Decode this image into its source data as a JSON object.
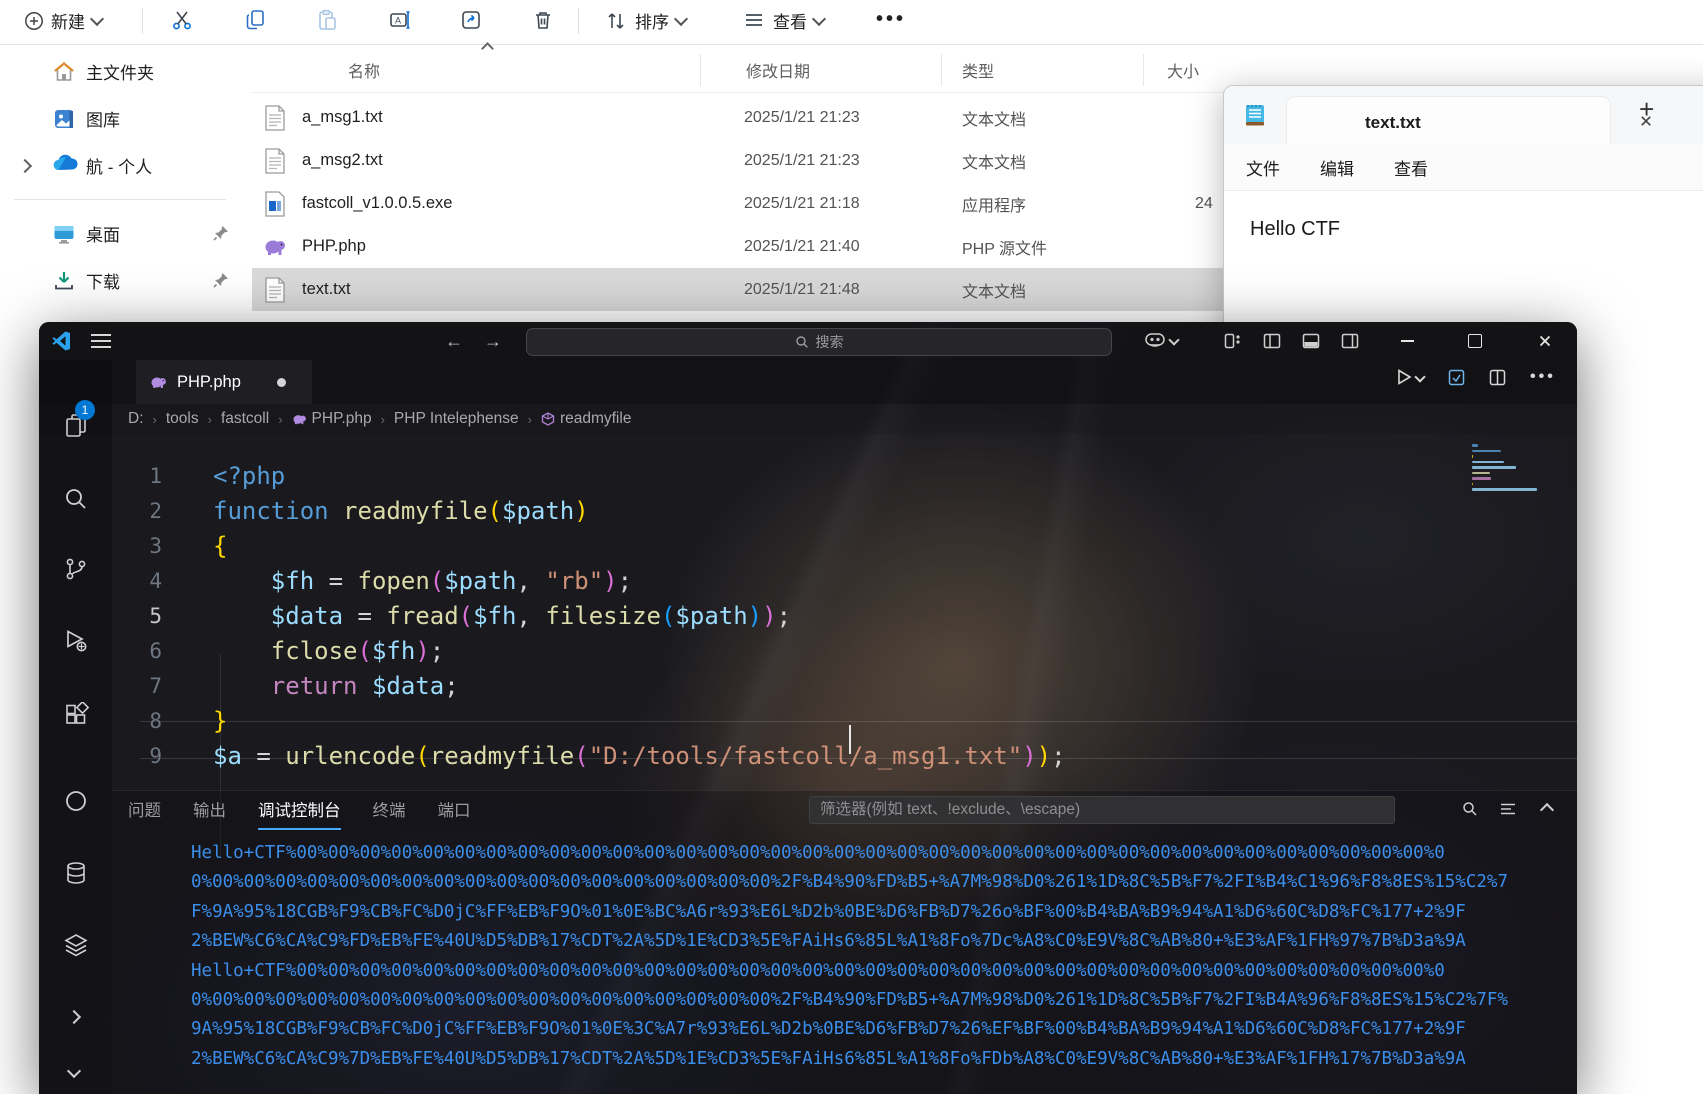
{
  "colors": {
    "accent": "#0078d4",
    "debug_console_text": "#3b8eea",
    "panel_tab_underline": "#47a9ff",
    "selected_row": "#d9d9d9"
  },
  "explorer": {
    "toolbar": {
      "new_label": "新建",
      "sort_label": "排序",
      "view_label": "查看",
      "icon_names": [
        "plus-circle-icon",
        "cut-icon",
        "copy-icon",
        "paste-icon",
        "rename-icon",
        "share-icon",
        "delete-icon",
        "sort-icon",
        "view-icon",
        "more-icon"
      ]
    },
    "columns": {
      "name": "名称",
      "modified": "修改日期",
      "type": "类型",
      "size": "大小"
    },
    "sidebar": [
      {
        "label": "主文件夹",
        "icon": "home-icon"
      },
      {
        "label": "图库",
        "icon": "gallery-icon"
      },
      {
        "label": "航 - 个人",
        "icon": "onedrive-icon",
        "expandable": true
      },
      {
        "divider": true
      },
      {
        "label": "桌面",
        "icon": "desktop-icon",
        "pinned": true
      },
      {
        "label": "下载",
        "icon": "download-icon",
        "pinned": true
      }
    ],
    "files": [
      {
        "name": "a_msg1.txt",
        "date": "2025/1/21 21:23",
        "type": "文本文档",
        "size": "",
        "icon": "txt",
        "selected": false
      },
      {
        "name": "a_msg2.txt",
        "date": "2025/1/21 21:23",
        "type": "文本文档",
        "size": "",
        "icon": "txt",
        "selected": false
      },
      {
        "name": "fastcoll_v1.0.0.5.exe",
        "date": "2025/1/21 21:18",
        "type": "应用程序",
        "size": "24",
        "icon": "exe",
        "selected": false
      },
      {
        "name": "PHP.php",
        "date": "2025/1/21 21:40",
        "type": "PHP 源文件",
        "size": "",
        "icon": "php",
        "selected": false
      },
      {
        "name": "text.txt",
        "date": "2025/1/21 21:48",
        "type": "文本文档",
        "size": "",
        "icon": "txt",
        "selected": true
      }
    ]
  },
  "notepad": {
    "tab_title": "text.txt",
    "menus": [
      "文件",
      "编辑",
      "查看"
    ],
    "body_text": "Hello CTF"
  },
  "vscode": {
    "command_center_label": "搜索",
    "tab": {
      "label": "PHP.php",
      "modified": true
    },
    "breadcrumbs": [
      {
        "label": "D:"
      },
      {
        "label": "tools"
      },
      {
        "label": "fastcoll"
      },
      {
        "label": "PHP.php",
        "icon": "php-elephant-icon"
      },
      {
        "label": "PHP Intelephense"
      },
      {
        "label": "readmyfile",
        "icon": "symbol-method-icon"
      }
    ],
    "activity_badge": "1",
    "code": {
      "lines": [
        [
          [
            "<?php",
            "c-kw"
          ]
        ],
        [
          [
            "function ",
            "c-kw"
          ],
          [
            "readmyfile",
            "c-fn"
          ],
          [
            "(",
            "c-b1"
          ],
          [
            "$path",
            "c-var"
          ],
          [
            ")",
            "c-b1"
          ]
        ],
        [
          [
            "{",
            "c-b1"
          ]
        ],
        [
          [
            "    ",
            "c-pl"
          ],
          [
            "$fh",
            "c-var"
          ],
          [
            " = ",
            "c-pl"
          ],
          [
            "fopen",
            "c-fn"
          ],
          [
            "(",
            "c-b2"
          ],
          [
            "$path",
            "c-var"
          ],
          [
            ", ",
            "c-pl"
          ],
          [
            "\"rb\"",
            "c-str"
          ],
          [
            ")",
            "c-b2"
          ],
          [
            ";",
            "c-pl"
          ]
        ],
        [
          [
            "    ",
            "c-pl"
          ],
          [
            "$data",
            "c-var"
          ],
          [
            " = ",
            "c-pl"
          ],
          [
            "fread",
            "c-fn"
          ],
          [
            "(",
            "c-b2"
          ],
          [
            "$fh",
            "c-var"
          ],
          [
            ", ",
            "c-pl"
          ],
          [
            "filesize",
            "c-fn"
          ],
          [
            "(",
            "c-b3"
          ],
          [
            "$path",
            "c-var"
          ],
          [
            ")",
            "c-b3"
          ],
          [
            ")",
            "c-b2"
          ],
          [
            ";",
            "c-pl"
          ]
        ],
        [
          [
            "    ",
            "c-pl"
          ],
          [
            "fclose",
            "c-fn"
          ],
          [
            "(",
            "c-b2"
          ],
          [
            "$fh",
            "c-var"
          ],
          [
            ")",
            "c-b2"
          ],
          [
            ";",
            "c-pl"
          ]
        ],
        [
          [
            "    ",
            "c-pl"
          ],
          [
            "return ",
            "c-ctl"
          ],
          [
            "$data",
            "c-var"
          ],
          [
            ";",
            "c-pl"
          ]
        ],
        [
          [
            "}",
            "c-b1"
          ]
        ],
        [
          [
            "$a",
            "c-var"
          ],
          [
            " = ",
            "c-pl"
          ],
          [
            "urlencode",
            "c-fn"
          ],
          [
            "(",
            "c-b1"
          ],
          [
            "readmyfile",
            "c-fn"
          ],
          [
            "(",
            "c-b2"
          ],
          [
            "\"D:/tools/fastcoll/a_msg1.txt\"",
            "c-str"
          ],
          [
            ")",
            "c-b2"
          ],
          [
            ")",
            "c-b1"
          ],
          [
            ";",
            "c-pl"
          ]
        ]
      ]
    },
    "panel": {
      "tabs": [
        {
          "label": "问题",
          "active": false
        },
        {
          "label": "输出",
          "active": false
        },
        {
          "label": "调试控制台",
          "active": true
        },
        {
          "label": "终端",
          "active": false
        },
        {
          "label": "端口",
          "active": false
        }
      ],
      "filter_placeholder": "筛选器(例如 text、!exclude、\\escape)",
      "console_lines": [
        "Hello+CTF%00%00%00%00%00%00%00%00%00%00%00%00%00%00%00%00%00%00%00%00%00%00%00%00%00%00%00%00%00%00%00%00%00%00%00%00%0",
        "0%00%00%00%00%00%00%00%00%00%00%00%00%00%00%00%00%00%00%2F%B4%90%FD%B5+%A7M%98%D0%261%1D%8C%5B%F7%2FI%B4%C1%96%F8%8ES%15%C2%7",
        "F%9A%95%18CGB%F9%CB%FC%D0jC%FF%EB%F9O%01%0E%BC%A6r%93%E6L%D2b%0BE%D6%FB%D7%26o%BF%00%B4%BA%B9%94%A1%D6%60C%D8%FC%177+2%9F",
        "2%BEW%C6%CA%C9%FD%EB%FE%40U%D5%DB%17%CDT%2A%5D%1E%CD3%5E%FAiHs6%85L%A1%8Fo%7Dc%A8%C0%E9V%8C%AB%80+%E3%AF%1FH%97%7B%D3a%9A",
        "Hello+CTF%00%00%00%00%00%00%00%00%00%00%00%00%00%00%00%00%00%00%00%00%00%00%00%00%00%00%00%00%00%00%00%00%00%00%00%00%0",
        "0%00%00%00%00%00%00%00%00%00%00%00%00%00%00%00%00%00%00%2F%B4%90%FD%B5+%A7M%98%D0%261%1D%8C%5B%F7%2FI%B4A%96%F8%8ES%15%C2%7F%",
        "9A%95%18CGB%F9%CB%FC%D0jC%FF%EB%F9O%01%0E%3C%A7r%93%E6L%D2b%0BE%D6%FB%D7%26%EF%BF%00%B4%BA%B9%94%A1%D6%60C%D8%FC%177+2%9F",
        "2%BEW%C6%CA%C9%7D%EB%FE%40U%D5%DB%17%CDT%2A%5D%1E%CD3%5E%FAiHs6%85L%A1%8Fo%FDb%A8%C0%E9V%8C%AB%80+%E3%AF%1FH%17%7B%D3a%9A"
      ]
    }
  }
}
